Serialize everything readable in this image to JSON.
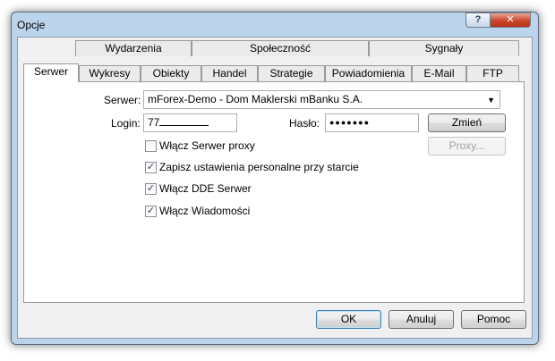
{
  "window": {
    "title": "Opcje"
  },
  "titlebar": {
    "help_glyph": "?",
    "close_glyph": "✕"
  },
  "tabs_row1": [
    "Wydarzenia",
    "Społeczność",
    "Sygnały"
  ],
  "tabs_row2": [
    "Serwer",
    "Wykresy",
    "Obiekty",
    "Handel",
    "Strategie",
    "Powiadomienia",
    "E-Mail",
    "FTP"
  ],
  "active_tab": "Serwer",
  "server": {
    "server_label": "Serwer:",
    "server_value": "mForex-Demo - Dom Maklerski mBanku S.A.",
    "login_label": "Login:",
    "login_value": "77",
    "password_label": "Hasło:",
    "password_value": "●●●●●●●",
    "change_button": "Zmień",
    "proxy_button": "Proxy...",
    "options": [
      {
        "label": "Włącz Serwer proxy",
        "checked": false
      },
      {
        "label": "Zapisz ustawienia personalne przy starcie",
        "checked": true
      },
      {
        "label": "Włącz DDE Serwer",
        "checked": true
      },
      {
        "label": "Włącz Wiadomości",
        "checked": true
      }
    ]
  },
  "footer": {
    "ok": "OK",
    "cancel": "Anuluj",
    "help": "Pomoc"
  },
  "colors": {
    "frame": "#bcd3ec",
    "close_button": "#c9442a",
    "dialog_bg": "#f0f0f0"
  }
}
